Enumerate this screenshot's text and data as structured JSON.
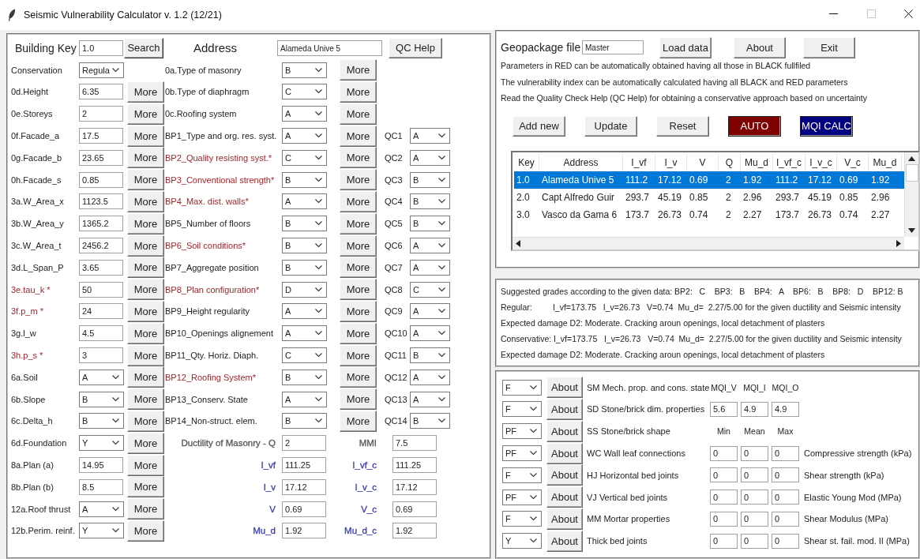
{
  "window": {
    "title": "Seismic Vulnerability Calculator v. 1.2 (12/21)"
  },
  "header": {
    "key_label": "Building Key",
    "key_value": "1.0",
    "search": "Search",
    "address_label": "Address",
    "address_value": "Alameda Unive 5",
    "help": "QC Help"
  },
  "left_fields": [
    {
      "label": "Conservation",
      "kind": "combo",
      "value": "Regula",
      "auto": false
    },
    {
      "label": "0d.Height",
      "kind": "entry",
      "value": "6.35",
      "auto": false,
      "button": "More"
    },
    {
      "label": "0e.Storeys",
      "kind": "entry",
      "value": "2",
      "auto": false,
      "button": "More"
    },
    {
      "label": "0f.Facade_a",
      "kind": "entry",
      "value": "17.5",
      "auto": false,
      "button": "More"
    },
    {
      "label": "0g.Facade_b",
      "kind": "entry",
      "value": "23.65",
      "auto": false,
      "button": "More"
    },
    {
      "label": "0h.Facade_s",
      "kind": "entry",
      "value": "0.85",
      "auto": false,
      "button": "More"
    },
    {
      "label": "3a.W_Area_x",
      "kind": "entry",
      "value": "1123.5",
      "auto": false,
      "button": "More"
    },
    {
      "label": "3b.W_Area_y",
      "kind": "entry",
      "value": "1365.2",
      "auto": false,
      "button": "More"
    },
    {
      "label": "3c.W_Area_t",
      "kind": "entry",
      "value": "2456.2",
      "auto": false,
      "button": "More"
    },
    {
      "label": "3d.L_Span_P",
      "kind": "entry",
      "value": "3.65",
      "auto": false,
      "button": "More"
    },
    {
      "label": "3e.tau_k *",
      "kind": "entry",
      "value": "50",
      "auto": true,
      "button": "More"
    },
    {
      "label": "3f.p_m *",
      "kind": "entry",
      "value": "24",
      "auto": true,
      "button": "More"
    },
    {
      "label": "3g.l_w",
      "kind": "entry",
      "value": "4.5",
      "auto": false,
      "button": "More"
    },
    {
      "label": "3h.p_s *",
      "kind": "entry",
      "value": "3",
      "auto": true,
      "button": "More"
    },
    {
      "label": "6a.Soil",
      "kind": "combo",
      "value": "A",
      "auto": false,
      "button": "More"
    },
    {
      "label": "6b.Slope",
      "kind": "combo",
      "value": "B",
      "auto": false,
      "button": "More"
    },
    {
      "label": "6c.Delta_h",
      "kind": "combo",
      "value": "B",
      "auto": false,
      "button": "More"
    },
    {
      "label": "6d.Foundation",
      "kind": "combo",
      "value": "Y",
      "auto": false,
      "button": "More"
    },
    {
      "label": "8a.Plan (a)",
      "kind": "entry",
      "value": "14.95",
      "auto": false,
      "button": "More"
    },
    {
      "label": "8b.Plan (b)",
      "kind": "entry",
      "value": "8.5",
      "auto": false,
      "button": "More"
    },
    {
      "label": "12a.Roof thrust",
      "kind": "combo",
      "value": "A",
      "auto": false,
      "button": "More"
    },
    {
      "label": "12b.Perim. reinf.",
      "kind": "combo",
      "value": "Y",
      "auto": false,
      "button": "More"
    }
  ],
  "parameters": [
    {
      "label": "0a.Type of masonry",
      "value": "B",
      "auto": false,
      "button": "More"
    },
    {
      "label": "0b.Type of diaphragm",
      "value": "C",
      "auto": false,
      "button": "More"
    },
    {
      "label": "0c.Roofing system",
      "value": "A",
      "auto": false,
      "button": "More"
    },
    {
      "label": "BP1_Type and org. res. syst.",
      "value": "A",
      "auto": false,
      "button": "More",
      "qc_label": "QC1",
      "qc_value": "A"
    },
    {
      "label": "BP2_Quality resisting syst.*",
      "value": "C",
      "auto": true,
      "button": "More",
      "qc_label": "QC2",
      "qc_value": "A"
    },
    {
      "label": "BP3_Conventional strength*",
      "value": "B",
      "auto": true,
      "button": "More",
      "qc_label": "QC3",
      "qc_value": "B"
    },
    {
      "label": "BP4_Max. dist. walls*",
      "value": "A",
      "auto": true,
      "button": "More",
      "qc_label": "QC4",
      "qc_value": "B"
    },
    {
      "label": "BP5_Number of floors",
      "value": "B",
      "auto": false,
      "button": "More",
      "qc_label": "QC5",
      "qc_value": "B"
    },
    {
      "label": "BP6_Soil conditions*",
      "value": "B",
      "auto": true,
      "button": "More",
      "qc_label": "QC6",
      "qc_value": "A"
    },
    {
      "label": "BP7_Aggregate position",
      "value": "B",
      "auto": false,
      "button": "More",
      "qc_label": "QC7",
      "qc_value": "A"
    },
    {
      "label": "BP8_Plan configuration*",
      "value": "D",
      "auto": true,
      "button": "More",
      "qc_label": "QC8",
      "qc_value": "C"
    },
    {
      "label": "BP9_Height regularity",
      "value": "A",
      "auto": false,
      "button": "More",
      "qc_label": "QC9",
      "qc_value": "A"
    },
    {
      "label": "BP10_Openings alignement",
      "value": "A",
      "auto": false,
      "button": "More",
      "qc_label": "QC10",
      "qc_value": "A"
    },
    {
      "label": "BP11_Qty. Horiz. Diaph.",
      "value": "C",
      "auto": false,
      "button": "More",
      "qc_label": "QC11",
      "qc_value": "B"
    },
    {
      "label": "BP12_Roofing System*",
      "value": "B",
      "auto": true,
      "button": "More",
      "qc_label": "QC12",
      "qc_value": "A"
    },
    {
      "label": "BP13_Conserv. State",
      "value": "A",
      "auto": false,
      "button": "More",
      "qc_label": "QC13",
      "qc_value": "A"
    },
    {
      "label": "BP14_Non-struct. elem.",
      "value": "B",
      "auto": false,
      "button": "More",
      "qc_label": "QC14",
      "qc_value": "B"
    }
  ],
  "results": [
    {
      "label": "Ductility of Masonry - Q",
      "value": "2",
      "right_label": "MMI",
      "right_value": "7.5",
      "color": "#555555"
    },
    {
      "label": "I_vf",
      "value": "111.25",
      "right_label": "I_vf_c",
      "right_value": "111.25",
      "color": "#3a3ab4"
    },
    {
      "label": "I_v",
      "value": "17.12",
      "right_label": "I_v_c",
      "right_value": "17.12",
      "color": "#3a3ab4"
    },
    {
      "label": "V",
      "value": "0.69",
      "right_label": "V_c",
      "right_value": "0.69",
      "color": "#3a3ab4"
    },
    {
      "label": "Mu_d",
      "value": "1.92",
      "right_label": "Mu_d_c",
      "right_value": "1.92",
      "color": "#3a3ab4"
    }
  ],
  "geopackage": {
    "label": "Geopackage file",
    "value": "Master",
    "buttons": [
      "Load data",
      "About",
      "Exit"
    ]
  },
  "info_lines": [
    "Parameters in RED can be automatically obtained having all those in BLACK fullfiled",
    "The vulnerability index can be automatically calculated having all BLACK and RED parameters",
    "Read the Quality Check Help (QC Help) for obtaining a conservative approach based on uncertainty"
  ],
  "actions": [
    {
      "label": "Add new",
      "kind": "plain"
    },
    {
      "label": "Update",
      "kind": "plain"
    },
    {
      "label": "Reset",
      "kind": "plain"
    },
    {
      "label": "AUTO",
      "kind": "auto"
    },
    {
      "label": "MQI CALC",
      "kind": "calc"
    }
  ],
  "table": {
    "columns": [
      "Key",
      "Address",
      "I_vf",
      "I_v",
      "V",
      "Q",
      "Mu_d",
      "I_vf_c",
      "I_v_c",
      "V_c",
      "Mu_d"
    ],
    "rows": [
      {
        "selected": true,
        "cells": [
          "1.0",
          "Alameda Unive 5",
          "111.2",
          "17.12",
          "0.69",
          "2",
          "1.92",
          "111.2",
          "17.12",
          "0.69",
          "1.92"
        ]
      },
      {
        "selected": false,
        "cells": [
          "2.0",
          "Capt Alfredo Guir",
          "293.7",
          "45.19",
          "0.85",
          "2",
          "2.96",
          "293.7",
          "45.19",
          "0.85",
          "2.96"
        ]
      },
      {
        "selected": false,
        "cells": [
          "3.0",
          "Vasco da Gama 6",
          "173.7",
          "26.73",
          "0.74",
          "2",
          "2.27",
          "173.7",
          "26.73",
          "0.74",
          "2.27"
        ]
      }
    ]
  },
  "output_lines": [
    "Suggested grades according to the given data: BP2:   C    BP3:   B    BP4:   A    BP6:   B    BP8:   D    BP12: B",
    "Regular:         I_vf=173.75   I_v=26.73   V=0.74  Mu_d=  2.27/5.00 for the given ductility and Seismic intensity",
    "Expected damage D2: Moderate. Cracking aroun openings, local detachment of plasters",
    "Conservative: I_vf=173.75   I_v=26.73   V=0.74  Mu_d=  2.27/5.00 for the given ductility and Seismic intensity",
    "Expected damage D2: Moderate. Cracking aroun openings, local detachment of plasters"
  ],
  "mqi_criteria": [
    {
      "grade": "F",
      "button": "About",
      "label": "SM Mech. prop. and cons. state"
    },
    {
      "grade": "F",
      "button": "About",
      "label": "SD Stone/brick dim. properties"
    },
    {
      "grade": "PF",
      "button": "About",
      "label": "SS Stone/brick shape"
    },
    {
      "grade": "PF",
      "button": "About",
      "label": "WC Wall leaf connections"
    },
    {
      "grade": "F",
      "button": "About",
      "label": "HJ Horizontal bed joints"
    },
    {
      "grade": "PF",
      "button": "About",
      "label": "VJ Vertical bed joints"
    },
    {
      "grade": "F",
      "button": "About",
      "label": "MM Mortar properties"
    },
    {
      "grade": "Y",
      "button": "About",
      "label": "Thick bed joints"
    }
  ],
  "mqi": {
    "headers": [
      "MQI_V",
      "MQI_I",
      "MQI_O"
    ],
    "values": [
      "5.6",
      "4.9",
      "4.9"
    ]
  },
  "properties": {
    "headers": [
      "Min",
      "Mean",
      "Max"
    ],
    "rows": [
      {
        "values": [
          "0",
          "0",
          "0"
        ],
        "label": "Compressive strength (kPa)"
      },
      {
        "values": [
          "0",
          "0",
          "0"
        ],
        "label": "Shear strength (kPa)"
      },
      {
        "values": [
          "0",
          "0",
          "0"
        ],
        "label": "Elastic Young Mod (MPa)"
      },
      {
        "values": [
          "0",
          "0",
          "0"
        ],
        "label": "Shear Modulus (MPa)"
      },
      {
        "values": [
          "0",
          "0",
          "0"
        ],
        "label": "Shear st. fail. mod. II (MPa)"
      }
    ]
  }
}
